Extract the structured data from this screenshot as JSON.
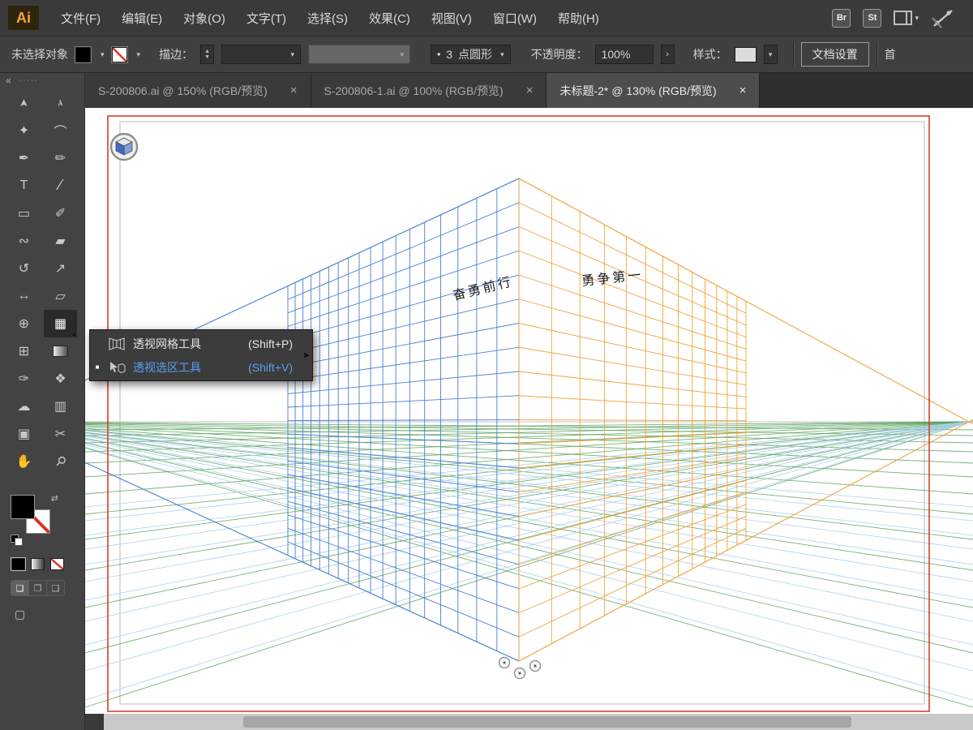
{
  "app": {
    "logo_text": "Ai"
  },
  "menubar": {
    "items": [
      "文件(F)",
      "编辑(E)",
      "对象(O)",
      "文字(T)",
      "选择(S)",
      "效果(C)",
      "视图(V)",
      "窗口(W)",
      "帮助(H)"
    ],
    "right": {
      "bridge": "Br",
      "stock": "St"
    }
  },
  "control_bar": {
    "no_selection": "未选择对象",
    "stroke_label": "描边：",
    "stepper_up": "▲",
    "stepper_down": "▼",
    "brush_dot": "•",
    "brush_size": "3",
    "brush_name": "点圆形",
    "opacity_label": "不透明度：",
    "opacity_value": "100%",
    "opacity_arrow": "›",
    "style_label": "样式：",
    "doc_setup_button": "文档设置",
    "preferences_partial": "首",
    "caret": "▾"
  },
  "tabs": [
    {
      "label": "S-200806.ai @ 150% (RGB/预览)",
      "close": "×",
      "active": false
    },
    {
      "label": "S-200806-1.ai @ 100% (RGB/预览)",
      "close": "×",
      "active": false
    },
    {
      "label": "未标题-2* @ 130% (RGB/预览)",
      "close": "×",
      "active": true
    }
  ],
  "toolbar": {
    "collapse": "«",
    "grip": "·····",
    "swap_icon": "⇄",
    "screen_mode_glyph": "▢",
    "draw_modes": [
      "❏",
      "❐",
      "❑"
    ],
    "tools": [
      {
        "name": "selection-tool",
        "glyph": "➤"
      },
      {
        "name": "direct-selection-tool",
        "glyph": "➢"
      },
      {
        "name": "magic-wand-tool",
        "glyph": "✦"
      },
      {
        "name": "lasso-tool",
        "glyph": "⌒"
      },
      {
        "name": "pen-tool",
        "glyph": "✒"
      },
      {
        "name": "pencil-tool",
        "glyph": "✏"
      },
      {
        "name": "type-tool",
        "glyph": "T"
      },
      {
        "name": "line-segment-tool",
        "glyph": "∕"
      },
      {
        "name": "rectangle-tool",
        "glyph": "▭"
      },
      {
        "name": "paintbrush-tool",
        "glyph": "✐"
      },
      {
        "name": "shaper-tool",
        "glyph": "∾"
      },
      {
        "name": "eraser-tool",
        "glyph": "▰"
      },
      {
        "name": "rotate-tool",
        "glyph": "↺"
      },
      {
        "name": "scale-tool",
        "glyph": "↗"
      },
      {
        "name": "width-tool",
        "glyph": "↔"
      },
      {
        "name": "free-transform-tool",
        "glyph": "▱"
      },
      {
        "name": "shape-builder-tool",
        "glyph": "⊕"
      },
      {
        "name": "perspective-grid-tool",
        "glyph": "▦",
        "pressed": true
      },
      {
        "name": "mesh-tool",
        "glyph": "⊞"
      },
      {
        "name": "gradient-tool",
        "glyph": ""
      },
      {
        "name": "eyedropper-tool",
        "glyph": "✑"
      },
      {
        "name": "blend-tool",
        "glyph": "❖"
      },
      {
        "name": "symbol-sprayer-tool",
        "glyph": "☁"
      },
      {
        "name": "column-graph-tool",
        "glyph": "▥"
      },
      {
        "name": "artboard-tool",
        "glyph": "▣"
      },
      {
        "name": "slice-tool",
        "glyph": "✂"
      },
      {
        "name": "hand-tool",
        "glyph": "✋"
      },
      {
        "name": "zoom-tool",
        "glyph": "⚲"
      }
    ]
  },
  "flyout": {
    "items": [
      {
        "label": "透视网格工具",
        "shortcut": "(Shift+P)",
        "active": false
      },
      {
        "label": "透视选区工具",
        "shortcut": "(Shift+V)",
        "active": true
      }
    ],
    "tear_arrow": "▶",
    "active_marker": "■"
  },
  "canvas": {
    "left_wall_text": "奋勇前行",
    "right_wall_text": "勇争第一"
  },
  "colors": {
    "accent_blue": "#58a0f0",
    "artboard_red": "#d4402e",
    "grid_blue": "#4b7fd0",
    "grid_orange": "#f0a43e",
    "grid_green": "#55a058",
    "grid_cyan": "#a5cde8",
    "horizon_gray": "#c6c6c6"
  }
}
